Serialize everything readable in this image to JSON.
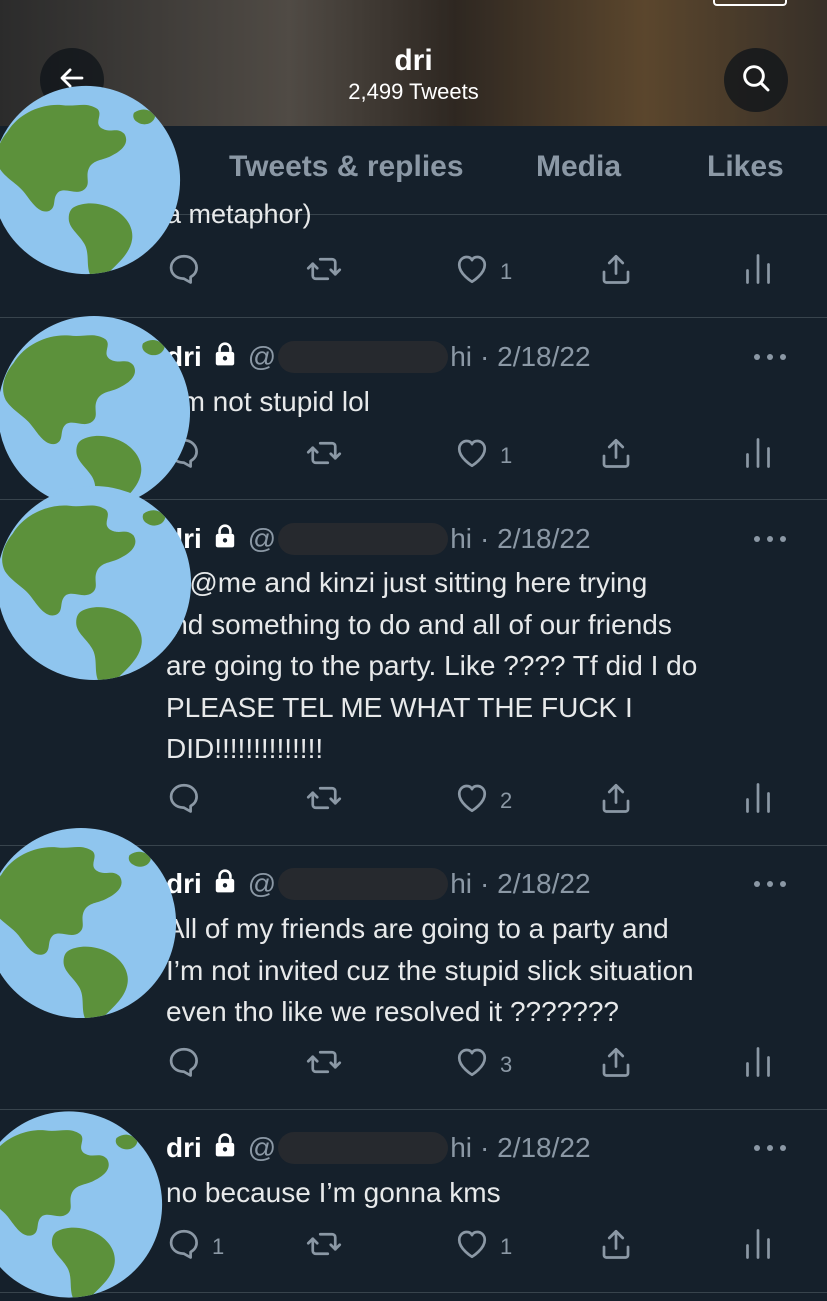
{
  "profile": {
    "name": "dri",
    "tweet_count": "2,499 Tweets"
  },
  "tabs": [
    {
      "label": "Tweets & replies"
    },
    {
      "label": "Media"
    },
    {
      "label": "Likes"
    }
  ],
  "partial_tweet": {
    "text_fragment": "a metaphor)",
    "reply_count": "",
    "retweet_count": "",
    "like_count": "1"
  },
  "tweets": [
    {
      "name": "dri",
      "handle_prefix": "@",
      "handle_tail": "hi",
      "date": "· 2/18/22",
      "text": "am not stupid lol",
      "reply_count": "",
      "retweet_count": "",
      "like_count": "1"
    },
    {
      "name": "dri",
      "handle_prefix": "@",
      "handle_tail": "hi",
      "date": "· 2/18/22",
      "text": "te@me and kinzi just sitting here trying\nind something to do and all of our friends\nare going to the party. Like ???? Tf did I do\nPLEASE TEL ME WHAT THE FUCK I\nDID!!!!!!!!!!!!!!",
      "reply_count": "",
      "retweet_count": "",
      "like_count": "2"
    },
    {
      "name": "dri",
      "handle_prefix": "@",
      "handle_tail": "hi",
      "date": "· 2/18/22",
      "text": "All of my friends are going to a party and\nI’m not invited cuz the stupid slick situation\neven tho like we resolved it ???????",
      "reply_count": "",
      "retweet_count": "",
      "like_count": "3"
    },
    {
      "name": "dri",
      "handle_prefix": "@",
      "handle_tail": "hi",
      "date": "· 2/18/22",
      "text": "no because I’m gonna kms",
      "reply_count": "1",
      "retweet_count": "",
      "like_count": "1"
    }
  ],
  "icons": {
    "back": "arrow-left-icon",
    "search": "search-icon",
    "avatar": "globe-americas-icon",
    "lock": "lock-icon",
    "more": "more-dots-icon",
    "reply": "reply-icon",
    "retweet": "retweet-icon",
    "like": "heart-icon",
    "share": "share-icon",
    "analytics": "analytics-icon"
  },
  "colors": {
    "background": "#15202b",
    "muted": "#8b98a5",
    "border": "#38444d",
    "globe_ocean": "#8fc5ee",
    "globe_land": "#5c913b"
  }
}
